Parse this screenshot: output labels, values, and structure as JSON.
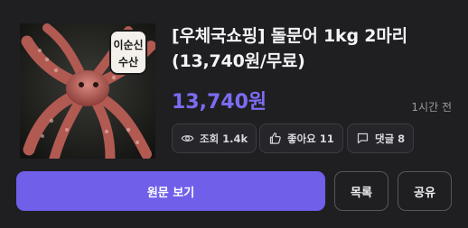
{
  "product": {
    "title_line1": "[우체국쇼핑] 돌문어 1kg 2마리",
    "title_line2": "(13,740원/무료)",
    "price": "13,740원",
    "posted": "1시간 전",
    "image_label_line1": "이순신",
    "image_label_line2": "수산"
  },
  "stats": {
    "views": "조회 1.4k",
    "likes": "좋아요 11",
    "comments": "댓글 8"
  },
  "actions": {
    "view_original": "원문 보기",
    "list": "목록",
    "share": "공유"
  },
  "colors": {
    "accent": "#6f5fe9",
    "price": "#7c6cf2",
    "background": "#1f1f22"
  },
  "icons": {
    "views": "eye-icon",
    "likes": "thumbs-up-icon",
    "comments": "comment-icon"
  }
}
